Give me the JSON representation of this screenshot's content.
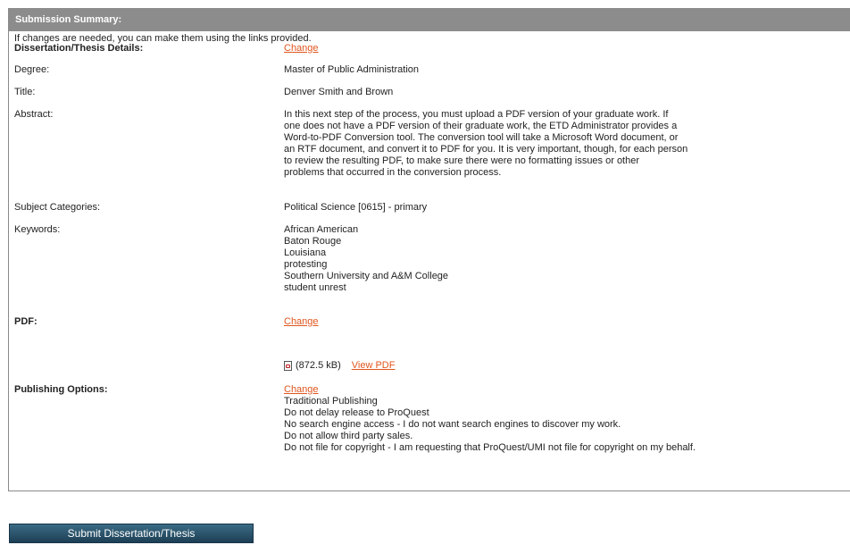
{
  "panel": {
    "title": "Submission Summary:",
    "intro": "If changes are needed, you can make them using the links provided."
  },
  "details": {
    "label": "Dissertation/Thesis Details:",
    "change": "Change"
  },
  "degree": {
    "label": "Degree:",
    "value": "Master of Public Administration"
  },
  "title": {
    "label": "Title:",
    "value": "Denver Smith and Brown"
  },
  "abstract": {
    "label": "Abstract:",
    "lines": [
      "In this next step of the process, you must upload a PDF version of your graduate work. If",
      "one does not have a PDF version of their graduate work, the ETD Administrator provides a",
      "Word-to-PDF Conversion tool. The conversion tool will take a Microsoft Word document, or",
      "an RTF document, and convert it to PDF for you. It is very important, though, for each person",
      "to review the resulting PDF, to make sure there were no formatting issues or other",
      "problems that occurred in the conversion process."
    ]
  },
  "subjects": {
    "label": "Subject Categories:",
    "value": "Political Science [0615] - primary"
  },
  "keywords": {
    "label": "Keywords:",
    "items": [
      "African American",
      "Baton Rouge",
      "Louisiana",
      "protesting",
      "Southern University and A&M College",
      "student unrest"
    ]
  },
  "pdf": {
    "label": "PDF:",
    "change": "Change",
    "icon": "pdf-file-icon",
    "size": "(872.5 kB)",
    "view": "View PDF"
  },
  "publishing": {
    "label": "Publishing Options:",
    "change": "Change",
    "lines": [
      "Traditional Publishing",
      "Do not delay release to ProQuest",
      "No search engine access - I do not want search engines to discover my work.",
      "Do not allow third party sales.",
      "Do not file for copyright - I am requesting that ProQuest/UMI not file for copyright on my behalf."
    ]
  },
  "submit": {
    "label": "Submit Dissertation/Thesis"
  },
  "colors": {
    "header_bg": "#8c8c8c",
    "link": "#e0561f",
    "button": "#1d3f55"
  }
}
